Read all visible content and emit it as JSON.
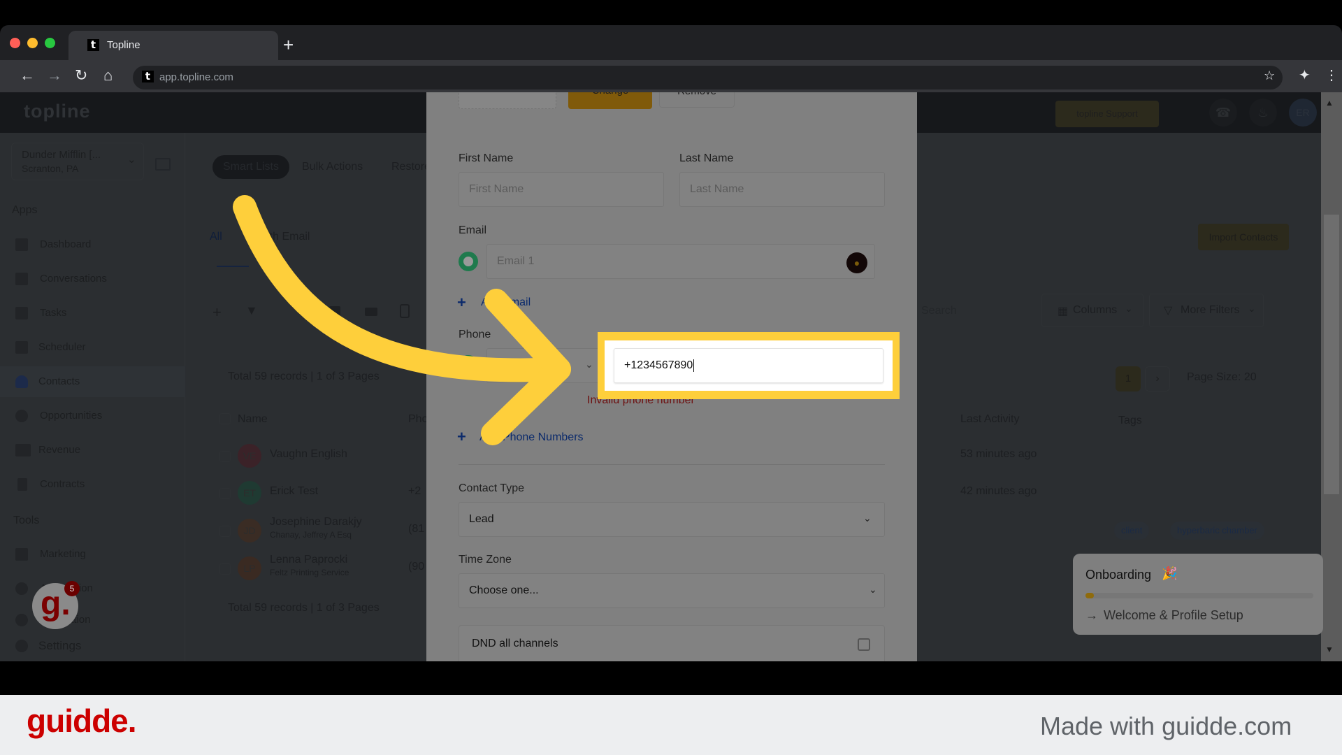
{
  "browser": {
    "tab_title": "Topline",
    "favicon_letter": "t",
    "new_tab": "+",
    "url": "app.topline.com",
    "icons": [
      "back-arrow-icon",
      "forward-arrow-icon",
      "reload-icon",
      "home-icon",
      "star-icon",
      "extensions-icon",
      "menu-icon"
    ]
  },
  "app": {
    "logo": "topline",
    "support_label": "topline Support",
    "avatar_initials": "ER",
    "account": {
      "name": "Dunder Mifflin [...",
      "location": "Scranton, PA"
    },
    "sidebar": {
      "apps_heading": "Apps",
      "apps": [
        {
          "label": "Dashboard"
        },
        {
          "label": "Conversations"
        },
        {
          "label": "Tasks"
        },
        {
          "label": "Scheduler"
        },
        {
          "label": "Contacts",
          "active": true
        },
        {
          "label": "Opportunities"
        },
        {
          "label": "Revenue"
        },
        {
          "label": "Contracts"
        }
      ],
      "tools_heading": "Tools",
      "tools": [
        {
          "label": "Marketing"
        },
        {
          "label": "Automation"
        },
        {
          "label": "Reputation"
        },
        {
          "label": "Settings"
        }
      ]
    },
    "top_tabs": [
      "Smart Lists",
      "Bulk Actions",
      "Restore"
    ],
    "list_tabs": [
      "All",
      "With Email"
    ],
    "import_label": "Import Contacts",
    "search_placeholder": "Search",
    "columns_label": "Columns",
    "more_filters_label": "More Filters",
    "total_records": "Total 59 records | 1 of 3 Pages",
    "pagination": {
      "current": "1",
      "page_size": "Page Size: 20"
    },
    "table": {
      "headers": {
        "name": "Name",
        "phone": "Phone",
        "last_activity": "Last Activity",
        "tags": "Tags"
      },
      "rows": [
        {
          "initials": "VE",
          "name": "Vaughn English",
          "company": "",
          "phone": "",
          "last_activity": "53 minutes ago",
          "tags": [],
          "color": "#3b2228"
        },
        {
          "initials": "ET",
          "name": "Erick Test",
          "company": "",
          "phone": "+2",
          "last_activity": "42 minutes ago",
          "tags": [],
          "color": "#1f3a32"
        },
        {
          "initials": "JD",
          "name": "Josephine Darakjy",
          "company": "Chanay, Jeffrey A Esq",
          "phone": "(81",
          "last_activity": "",
          "tags": [
            "client",
            "hyperbaric chamber"
          ],
          "color": "#3a2c24"
        },
        {
          "initials": "LP",
          "name": "Lenna Paprocki",
          "company": "Feltz Printing Service",
          "phone": "(90",
          "last_activity": "",
          "tags": [],
          "color": "#3a2a22"
        }
      ]
    }
  },
  "modal": {
    "change_label": "Change",
    "remove_label": "Remove",
    "first_name_label": "First Name",
    "first_name_placeholder": "First Name",
    "last_name_label": "Last Name",
    "last_name_placeholder": "Last Name",
    "email_label": "Email",
    "email_placeholder": "Email 1",
    "add_email_label": "Add email",
    "phone_label": "Phone",
    "phone_value": "+1234567890",
    "phone_error": "Invalid phone number",
    "add_phone_label": "Add Phone Numbers",
    "contact_type_label": "Contact Type",
    "contact_type_value": "Lead",
    "time_zone_label": "Time Zone",
    "time_zone_value": "Choose one...",
    "dnd_label": "DND all channels",
    "dnd_checked": false
  },
  "onboarding": {
    "title": "Onboarding",
    "emoji": "🎉",
    "progress_fraction": 0.02,
    "step": "Welcome & Profile Setup"
  },
  "guidde": {
    "badge_count": "5",
    "logo": "guidde.",
    "made_with": "Made with guidde.com",
    "brand_color": "#cc0000",
    "highlight_color": "#fecf3b"
  }
}
